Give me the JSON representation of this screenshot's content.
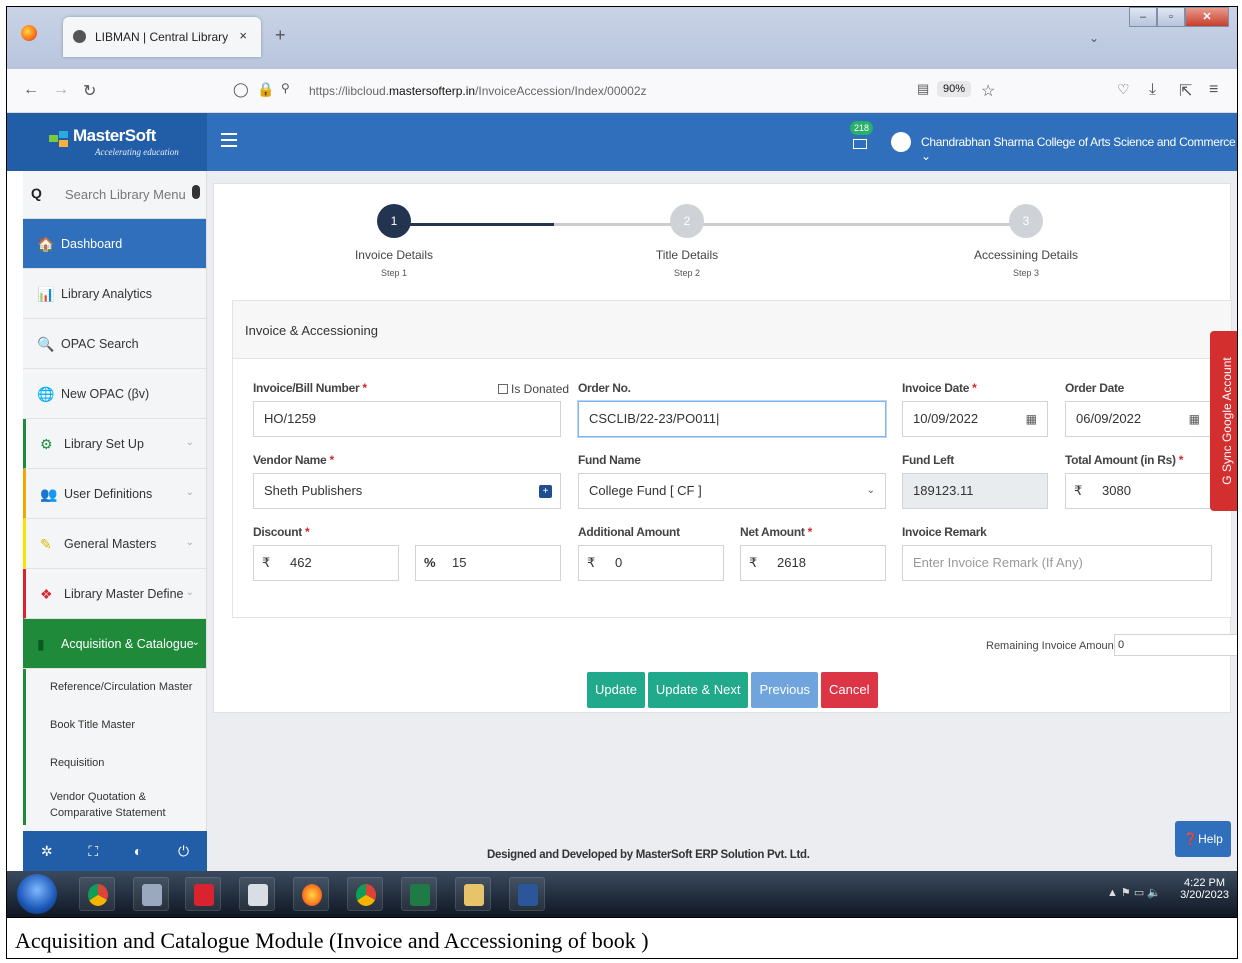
{
  "browser": {
    "tab_title": "LIBMAN | Central Library",
    "tab_close": "×",
    "new_tab": "+",
    "url_prefix": "https://libcloud.",
    "url_domain": "mastersofterp.in",
    "url_path": "/InvoiceAccession/Index/00002z",
    "zoom": "90%"
  },
  "header": {
    "brand_name": "MasterSoft",
    "brand_tagline": "Accelerating education",
    "mail_count": "218",
    "college_name": "Chandrabhan Sharma College of Arts Science and Commerce",
    "college_chevron": "⌄"
  },
  "sidebar": {
    "search_placeholder": "Search Library Menu",
    "items": [
      {
        "label": "Dashboard",
        "icon": "home-icon",
        "glyph": "🏠"
      },
      {
        "label": "Library Analytics",
        "icon": "bar-chart-icon",
        "glyph": "📊"
      },
      {
        "label": "OPAC Search",
        "icon": "search-circle-icon",
        "glyph": "🔍"
      },
      {
        "label": "New OPAC (βv)",
        "icon": "globe-icon",
        "glyph": "🌐"
      },
      {
        "label": "Library Set Up",
        "icon": "gears-icon",
        "glyph": "⚙"
      },
      {
        "label": "User Definitions",
        "icon": "users-icon",
        "glyph": "👥"
      },
      {
        "label": "General Masters",
        "icon": "edit-icon",
        "glyph": "✎"
      },
      {
        "label": "Library Master Define",
        "icon": "cubes-icon",
        "glyph": "❖"
      },
      {
        "label": "Acquisition & Catalogue",
        "icon": "book-icon",
        "glyph": "▮"
      }
    ],
    "sub_items": [
      "Reference/Circulation Master",
      "Book Title Master",
      "Requisition",
      "Vendor Quotation & Comparative Statement"
    ]
  },
  "stepper": {
    "steps": [
      {
        "number": "1",
        "title": "Invoice Details",
        "sub": "Step 1"
      },
      {
        "number": "2",
        "title": "Title Details",
        "sub": "Step 2"
      },
      {
        "number": "3",
        "title": "Accessining Details",
        "sub": "Step 3"
      }
    ]
  },
  "form": {
    "panel_title": "Invoice & Accessioning",
    "invoice_number_label": "Invoice/Bill Number",
    "invoice_number_value": "HO/1259",
    "is_donated_label": "Is Donated",
    "order_no_label": "Order No.",
    "order_no_value": "CSCLIB/22-23/PO011|",
    "invoice_date_label": "Invoice Date",
    "invoice_date_value": "10/09/2022",
    "order_date_label": "Order Date",
    "order_date_value": "06/09/2022",
    "vendor_label": "Vendor Name",
    "vendor_value": "Sheth Publishers",
    "fund_name_label": "Fund Name",
    "fund_name_value": "College Fund [ CF ]",
    "fund_left_label": "Fund Left",
    "fund_left_value": "189123.11",
    "total_amount_label": "Total Amount (in Rs)",
    "total_amount_value": "3080",
    "discount_label": "Discount",
    "discount_value": "462",
    "discount_percent_value": "15",
    "additional_label": "Additional Amount",
    "additional_value": "0",
    "net_label": "Net Amount",
    "net_value": "2618",
    "remark_label": "Invoice Remark",
    "remark_placeholder": "Enter Invoice Remark (If Any)",
    "required_mark": "*",
    "currency": "₹",
    "percent_symbol": "%",
    "remaining_label": "Remaining Invoice Amount :",
    "remaining_value": "0"
  },
  "buttons": {
    "update": "Update",
    "update_next": "Update & Next",
    "previous": "Previous",
    "cancel": "Cancel"
  },
  "footer": {
    "text": "Designed and Developed by MasterSoft ERP Solution Pvt. Ltd.",
    "help": "❓Help",
    "sync": "G Sync Google Account"
  },
  "taskbar": {
    "time": "4:22 PM",
    "date": "3/20/2023"
  },
  "caption": "Acquisition and Catalogue Module (Invoice and Accessioning of book )",
  "colors": {
    "primary": "#2f6fbb",
    "green": "#1f8a3a",
    "teal_button": "#20a98b",
    "danger": "#dc3545"
  }
}
